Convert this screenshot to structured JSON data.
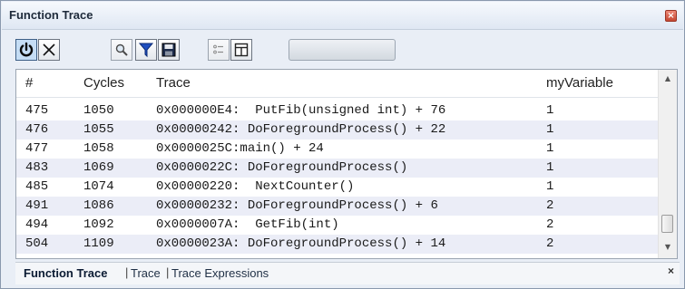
{
  "window": {
    "title": "Function Trace"
  },
  "toolbar": {
    "buttons": [
      {
        "name": "power",
        "icon": "power-icon"
      },
      {
        "name": "clear",
        "icon": "close-icon"
      },
      {
        "name": "search",
        "icon": "magnifier-icon"
      },
      {
        "name": "filter",
        "icon": "funnel-icon"
      },
      {
        "name": "save",
        "icon": "floppy-icon"
      },
      {
        "name": "options",
        "icon": "list-icon"
      },
      {
        "name": "columns",
        "icon": "table-icon"
      }
    ]
  },
  "table": {
    "columns": [
      "#",
      "Cycles",
      "Trace",
      "myVariable"
    ],
    "rows": [
      {
        "num": "475",
        "cycles": "1050",
        "trace": "0x000000E4:  PutFib(unsigned int) + 76",
        "var": "1"
      },
      {
        "num": "476",
        "cycles": "1055",
        "trace": "0x00000242: DoForegroundProcess() + 22",
        "var": "1"
      },
      {
        "num": "477",
        "cycles": "1058",
        "trace": "0x0000025C:main() + 24",
        "var": "1"
      },
      {
        "num": "483",
        "cycles": "1069",
        "trace": "0x0000022C: DoForegroundProcess()",
        "var": "1"
      },
      {
        "num": "485",
        "cycles": "1074",
        "trace": "0x00000220:  NextCounter()",
        "var": "1"
      },
      {
        "num": "491",
        "cycles": "1086",
        "trace": "0x00000232: DoForegroundProcess() + 6",
        "var": "2"
      },
      {
        "num": "494",
        "cycles": "1092",
        "trace": "0x0000007A:  GetFib(int)",
        "var": "2"
      },
      {
        "num": "504",
        "cycles": "1109",
        "trace": "0x0000023A: DoForegroundProcess() + 14",
        "var": "2"
      }
    ]
  },
  "tabs": [
    {
      "label": "Function Trace",
      "active": true
    },
    {
      "label": "Trace",
      "active": false
    },
    {
      "label": "Trace Expressions",
      "active": false
    }
  ],
  "separators": [
    "|",
    "|"
  ],
  "tab_close": "×",
  "title_close": "×",
  "scroll_up": "▲",
  "scroll_down": "▼",
  "colors": {
    "active_toggle": "#c5ddf5",
    "row_alt": "#ebedf7",
    "close_red": "#d4573f"
  }
}
